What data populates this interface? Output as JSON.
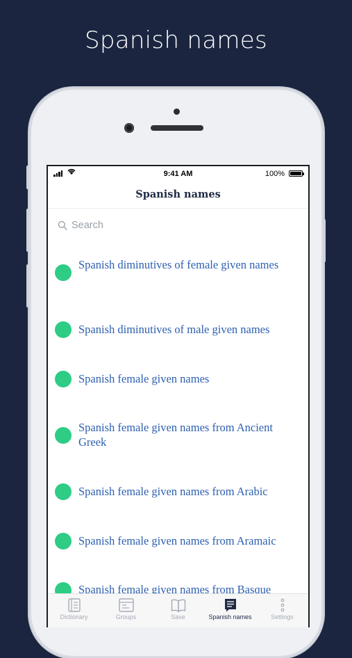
{
  "hero": {
    "title": "Spanish names"
  },
  "status_bar": {
    "time": "9:41 AM",
    "battery": "100%"
  },
  "nav": {
    "title": "Spanish names"
  },
  "search": {
    "placeholder": "Search"
  },
  "list_items": [
    "Spanish diminutives of female given names",
    "Spanish diminutives of male given names",
    "Spanish female given names",
    "Spanish female given names from Ancient Greek",
    "Spanish female given names from Arabic",
    "Spanish female given names from Aramaic",
    "Spanish female given names from Basque"
  ],
  "tabs": [
    {
      "label": "Dictionary",
      "icon": "dictionary-icon",
      "active": false
    },
    {
      "label": "Groups",
      "icon": "groups-icon",
      "active": false
    },
    {
      "label": "Save",
      "icon": "book-icon",
      "active": false
    },
    {
      "label": "Spanish names",
      "icon": "list-icon",
      "active": true
    },
    {
      "label": "Settings",
      "icon": "more-icon",
      "active": false
    }
  ],
  "colors": {
    "background": "#1b2540",
    "accent_green": "#2ecc84",
    "link_blue": "#2d5fb0",
    "nav_text": "#1f2a44"
  }
}
